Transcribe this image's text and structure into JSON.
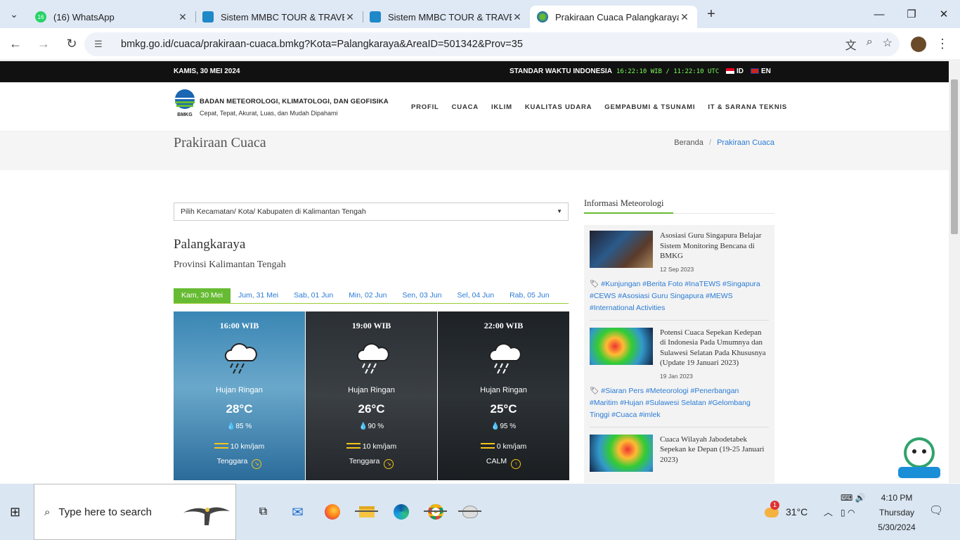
{
  "browser": {
    "tabs": [
      {
        "title": "(16) WhatsApp",
        "favicon": "whatsapp-icon",
        "badge": "16",
        "color": "#25d366"
      },
      {
        "title": "Sistem MMBC TOUR & TRAVEL",
        "favicon": "site-icon",
        "color": "#1e88c8"
      },
      {
        "title": "Sistem MMBC TOUR & TRAVEL",
        "favicon": "site-icon",
        "color": "#1e88c8"
      },
      {
        "title": "Prakiraan Cuaca Palangkaraya -",
        "favicon": "bmkg-icon",
        "color": "#1a66b3"
      }
    ],
    "url": "bmkg.go.id/cuaca/prakiraan-cuaca.bmkg?Kota=Palangkaraya&AreaID=501342&Prov=35"
  },
  "site": {
    "topbar": {
      "date": "KAMIS, 30 MEI 2024",
      "std_label": "STANDAR WAKTU INDONESIA",
      "clock": "16:22:10 WIB / 11:22:10 UTC",
      "lang_id": "ID",
      "lang_en": "EN"
    },
    "org_name": "BADAN METEOROLOGI, KLIMATOLOGI, DAN GEOFISIKA",
    "tagline": "Cepat, Tepat, Akurat, Luas, dan Mudah Dipahami",
    "logo_text": "BMKG",
    "nav": [
      "PROFIL",
      "CUACA",
      "IKLIM",
      "KUALITAS UDARA",
      "GEMPABUMI & TSUNAMI",
      "IT & SARANA TEKNIS"
    ],
    "page_title": "Prakiraan Cuaca",
    "breadcrumb": {
      "home": "Beranda",
      "sep": "/",
      "current": "Prakiraan Cuaca"
    },
    "select_placeholder": "Pilih Kecamatan/ Kota/ Kabupaten di Kalimantan Tengah",
    "city": "Palangkaraya",
    "province": "Provinsi Kalimantan Tengah",
    "day_tabs": [
      "Kam, 30 Mei",
      "Jum, 31 Mei",
      "Sab, 01 Jun",
      "Min, 02 Jun",
      "Sen, 03 Jun",
      "Sel, 04 Jun",
      "Rab, 05 Jun"
    ],
    "forecasts": [
      {
        "time": "16:00 WIB",
        "desc": "Hujan Ringan",
        "temp": "28°C",
        "humidity": "85 %",
        "wind": "10 km/jam",
        "dir": "Tenggara"
      },
      {
        "time": "19:00 WIB",
        "desc": "Hujan Ringan",
        "temp": "26°C",
        "humidity": "90 %",
        "wind": "10 km/jam",
        "dir": "Tenggara"
      },
      {
        "time": "22:00 WIB",
        "desc": "Hujan Ringan",
        "temp": "25°C",
        "humidity": "95 %",
        "wind": "0 km/jam",
        "dir": "CALM"
      }
    ],
    "sidebar": {
      "header": "Informasi Meteorologi",
      "news": [
        {
          "title": "Asosiasi Guru Singapura Belajar Sistem Monitoring Bencana di BMKG",
          "date": "12 Sep 2023",
          "tags": "#Kunjungan #Berita Foto #InaTEWS #Singapura #CEWS #Asosiasi Guru Singapura #MEWS #International Activities"
        },
        {
          "title": "Potensi Cuaca Sepekan Kedepan di Indonesia Pada Umumnya dan Sulawesi Selatan Pada Khususnya (Update 19 Januari 2023)",
          "date": "19 Jan 2023",
          "tags": "#Siaran Pers #Meteorologi #Penerbangan #Maritim #Hujan #Sulawesi Selatan #Gelombang Tinggi #Cuaca #imlek"
        },
        {
          "title": "Cuaca Wilayah Jabodetabek Sepekan ke Depan (19-25 Januari 2023)"
        }
      ]
    }
  },
  "taskbar": {
    "search_placeholder": "Type here to search",
    "weather_temp": "31°C",
    "weather_badge": "1",
    "time": "4:10 PM",
    "day": "Thursday",
    "date": "5/30/2024"
  }
}
